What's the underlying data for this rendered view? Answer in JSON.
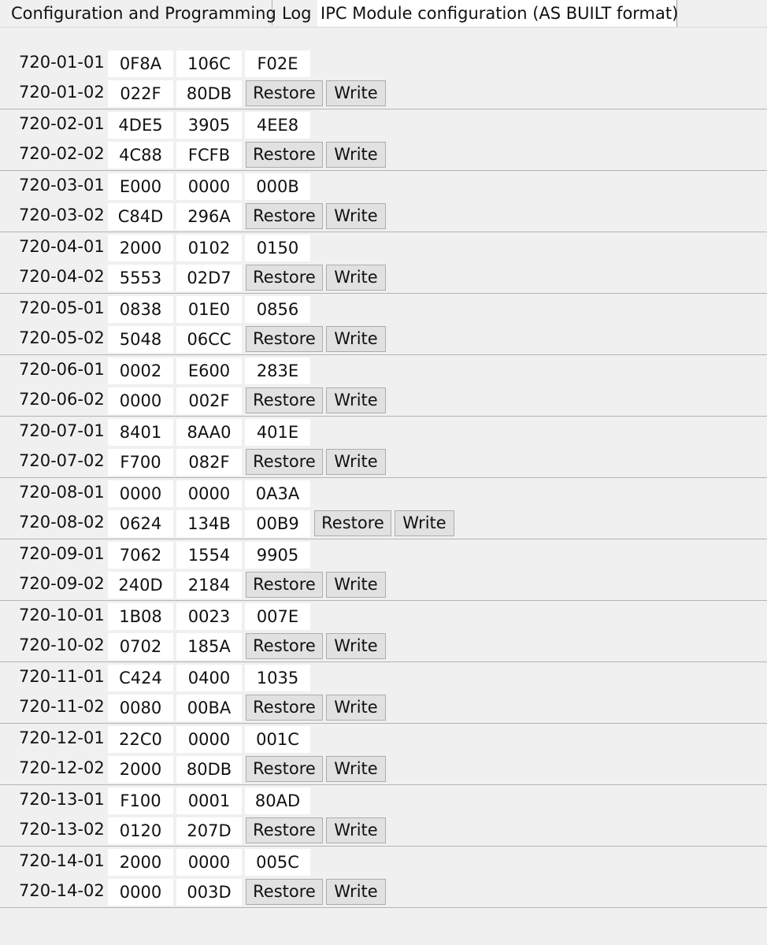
{
  "tabs": [
    {
      "label": "Configuration and Programming"
    },
    {
      "label": "Log"
    },
    {
      "label": "IPC Module configuration (AS BUILT format)"
    }
  ],
  "buttons": {
    "restore_label": "Restore",
    "write_label": "Write"
  },
  "groups": [
    {
      "row1": {
        "label": "720-01-01",
        "values": [
          "0F8A",
          "106C",
          "F02E"
        ]
      },
      "row2": {
        "label": "720-01-02",
        "values": [
          "022F",
          "80DB"
        ]
      }
    },
    {
      "row1": {
        "label": "720-02-01",
        "values": [
          "4DE5",
          "3905",
          "4EE8"
        ]
      },
      "row2": {
        "label": "720-02-02",
        "values": [
          "4C88",
          "FCFB"
        ]
      }
    },
    {
      "row1": {
        "label": "720-03-01",
        "values": [
          "E000",
          "0000",
          "000B"
        ]
      },
      "row2": {
        "label": "720-03-02",
        "values": [
          "C84D",
          "296A"
        ]
      }
    },
    {
      "row1": {
        "label": "720-04-01",
        "values": [
          "2000",
          "0102",
          "0150"
        ]
      },
      "row2": {
        "label": "720-04-02",
        "values": [
          "5553",
          "02D7"
        ]
      }
    },
    {
      "row1": {
        "label": "720-05-01",
        "values": [
          "0838",
          "01E0",
          "0856"
        ]
      },
      "row2": {
        "label": "720-05-02",
        "values": [
          "5048",
          "06CC"
        ]
      }
    },
    {
      "row1": {
        "label": "720-06-01",
        "values": [
          "0002",
          "E600",
          "283E"
        ]
      },
      "row2": {
        "label": "720-06-02",
        "values": [
          "0000",
          "002F"
        ]
      }
    },
    {
      "row1": {
        "label": "720-07-01",
        "values": [
          "8401",
          "8AA0",
          "401E"
        ]
      },
      "row2": {
        "label": "720-07-02",
        "values": [
          "F700",
          "082F"
        ]
      }
    },
    {
      "row1": {
        "label": "720-08-01",
        "values": [
          "0000",
          "0000",
          "0A3A"
        ]
      },
      "row2": {
        "label": "720-08-02",
        "values": [
          "0624",
          "134B",
          "00B9"
        ]
      }
    },
    {
      "row1": {
        "label": "720-09-01",
        "values": [
          "7062",
          "1554",
          "9905"
        ]
      },
      "row2": {
        "label": "720-09-02",
        "values": [
          "240D",
          "2184"
        ]
      }
    },
    {
      "row1": {
        "label": "720-10-01",
        "values": [
          "1B08",
          "0023",
          "007E"
        ]
      },
      "row2": {
        "label": "720-10-02",
        "values": [
          "0702",
          "185A"
        ]
      }
    },
    {
      "row1": {
        "label": "720-11-01",
        "values": [
          "C424",
          "0400",
          "1035"
        ]
      },
      "row2": {
        "label": "720-11-02",
        "values": [
          "0080",
          "00BA"
        ]
      }
    },
    {
      "row1": {
        "label": "720-12-01",
        "values": [
          "22C0",
          "0000",
          "001C"
        ]
      },
      "row2": {
        "label": "720-12-02",
        "values": [
          "2000",
          "80DB"
        ]
      }
    },
    {
      "row1": {
        "label": "720-13-01",
        "values": [
          "F100",
          "0001",
          "80AD"
        ]
      },
      "row2": {
        "label": "720-13-02",
        "values": [
          "0120",
          "207D"
        ]
      }
    },
    {
      "row1": {
        "label": "720-14-01",
        "values": [
          "2000",
          "0000",
          "005C"
        ]
      },
      "row2": {
        "label": "720-14-02",
        "values": [
          "0000",
          "003D"
        ]
      }
    }
  ]
}
